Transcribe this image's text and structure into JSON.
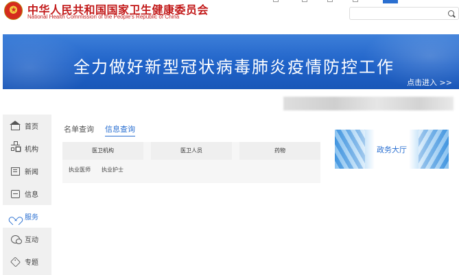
{
  "header": {
    "title_cn": "中华人民共和国国家卫生健康委员会",
    "title_en": "National Health Commission of the People's Republic of China",
    "search": {
      "value": "",
      "placeholder": ""
    }
  },
  "banner": {
    "title": "全力做好新型冠状病毒肺炎疫情防控工作",
    "link": "点击进入 >>"
  },
  "sidebar": {
    "items": [
      {
        "label": "首页",
        "icon": "home-icon",
        "active": false
      },
      {
        "label": "机构",
        "icon": "org-icon",
        "active": false
      },
      {
        "label": "新闻",
        "icon": "news-icon",
        "active": false
      },
      {
        "label": "信息",
        "icon": "info-icon",
        "active": false
      },
      {
        "label": "服务",
        "icon": "heart-icon",
        "active": true
      },
      {
        "label": "互动",
        "icon": "chat-icon",
        "active": false
      },
      {
        "label": "专题",
        "icon": "tag-icon",
        "active": false
      }
    ]
  },
  "main": {
    "tabs": [
      {
        "label": "名单查询",
        "active": false
      },
      {
        "label": "信息查询",
        "active": true
      }
    ],
    "categories": [
      "医卫机构",
      "医卫人员",
      "药物"
    ],
    "subcategories": [
      "执业医师",
      "执业护士"
    ]
  },
  "gov_hall": {
    "label": "政务大厅"
  },
  "colors": {
    "brand_red": "#c21a1a",
    "accent_blue": "#2a6fd1",
    "banner_blue": "#1f62c8",
    "sidebar_bg": "#f0f0f0"
  }
}
